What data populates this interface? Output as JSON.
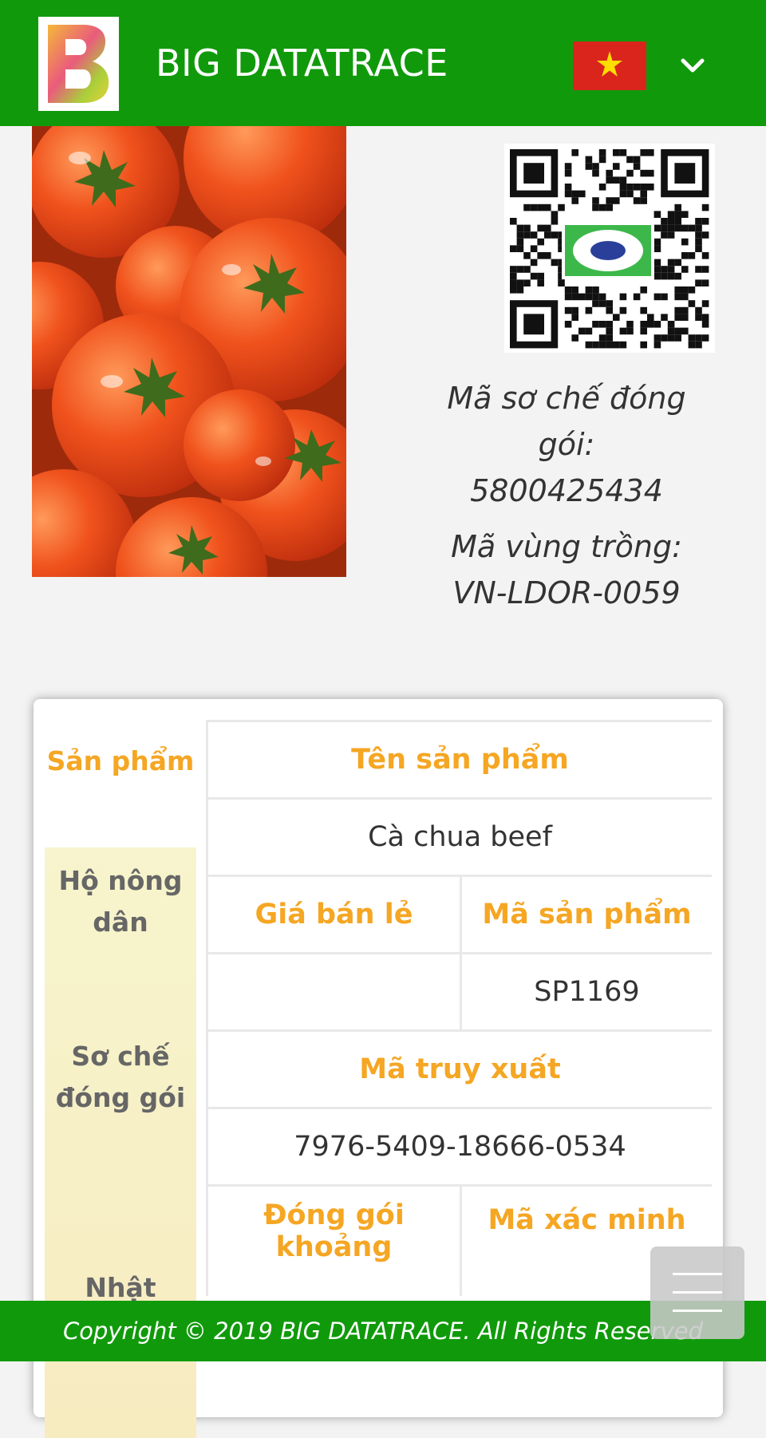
{
  "header": {
    "logo_letter": "B",
    "brand": "BIG DATATRACE",
    "language_flag": "vietnam-flag-icon",
    "menu_chevron": "chevron-down-icon",
    "colors": {
      "bar": "#109a0b",
      "accent": "#f5a623"
    }
  },
  "product": {
    "image": "tomatoes-photo",
    "qr": "qr-code",
    "packing_code_label": "Mã sơ chế đóng gói:",
    "packing_code_value": "5800425434",
    "growing_area_label": "Mã vùng trồng:",
    "growing_area_value": "VN-LDOR-0059"
  },
  "tabs": [
    {
      "label": "Sản phẩm",
      "active": true
    },
    {
      "label": "Hộ nông dân",
      "active": false
    },
    {
      "label": "Sơ chế đóng gói",
      "active": false
    },
    {
      "label": "Nhật",
      "active": false
    }
  ],
  "details": {
    "name_header": "Tên sản phẩm",
    "name_value": "Cà chua beef",
    "retail_price_header": "Giá bán lẻ",
    "retail_price_value": "",
    "product_code_header": "Mã sản phẩm",
    "product_code_value": "SP1169",
    "trace_code_header": "Mã truy xuất",
    "trace_code_value": "7976-5409-18666-0534",
    "packed_header": "Đóng gói khoảng",
    "verify_code_header": "Mã xác minh"
  },
  "footer": {
    "copyright": "Copyright © 2019 BIG DATATRACE. All Rights Reserved"
  },
  "floating_menu": "hamburger-menu-icon"
}
